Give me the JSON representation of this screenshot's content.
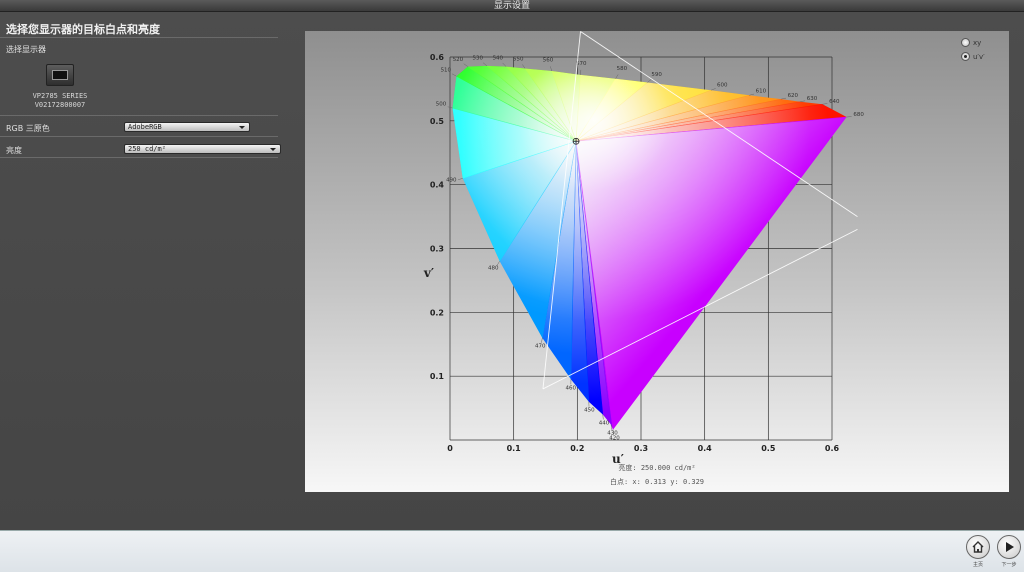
{
  "window": {
    "title": "显示设置"
  },
  "page": {
    "heading": "选择您显示器的目标白点和亮度"
  },
  "left": {
    "select_display_label": "选择显示器",
    "monitor_model": "VP2785 SERIES",
    "monitor_serial": "V02172800007",
    "rgb_label": "RGB 三原色",
    "rgb_value": "AdobeRGB",
    "brightness_label": "亮度",
    "brightness_value": "250 cd/m²"
  },
  "radios": [
    {
      "label": "xy",
      "selected": false
    },
    {
      "label": "u′v′",
      "selected": true
    }
  ],
  "chart_info": {
    "brightness_text": "亮度:  250.000 cd/m²",
    "whitepoint_text": "白点:  x: 0.313  y: 0.329"
  },
  "chart_data": {
    "type": "scatter",
    "title": "",
    "xlabel": "u′",
    "ylabel": "v′",
    "xlim": [
      0,
      0.6
    ],
    "ylim": [
      0,
      0.6
    ],
    "x_ticks": [
      "0",
      "0.1",
      "0.2",
      "0.3",
      "0.4",
      "0.5",
      "0.6"
    ],
    "y_ticks": [
      "0.1",
      "0.2",
      "0.3",
      "0.4",
      "0.5",
      "0.6"
    ],
    "grid": true,
    "spectral_locus": [
      {
        "nm": "420",
        "u": 0.256,
        "v": 0.016
      },
      {
        "nm": "430",
        "u": 0.253,
        "v": 0.024
      },
      {
        "nm": "440",
        "u": 0.24,
        "v": 0.04
      },
      {
        "nm": "450",
        "u": 0.218,
        "v": 0.06
      },
      {
        "nm": "460",
        "u": 0.19,
        "v": 0.095
      },
      {
        "nm": "470",
        "u": 0.145,
        "v": 0.16
      },
      {
        "nm": "480",
        "u": 0.078,
        "v": 0.28
      },
      {
        "nm": "490",
        "u": 0.02,
        "v": 0.41
      },
      {
        "nm": "500",
        "u": 0.004,
        "v": 0.52
      },
      {
        "nm": "510",
        "u": 0.01,
        "v": 0.57
      },
      {
        "nm": "520",
        "u": 0.028,
        "v": 0.585
      },
      {
        "nm": "530",
        "u": 0.058,
        "v": 0.586
      },
      {
        "nm": "540",
        "u": 0.088,
        "v": 0.585
      },
      {
        "nm": "550",
        "u": 0.118,
        "v": 0.582
      },
      {
        "nm": "560",
        "u": 0.16,
        "v": 0.578
      },
      {
        "nm": "570",
        "u": 0.205,
        "v": 0.572
      },
      {
        "nm": "580",
        "u": 0.26,
        "v": 0.566
      },
      {
        "nm": "590",
        "u": 0.31,
        "v": 0.56
      },
      {
        "nm": "600",
        "u": 0.41,
        "v": 0.548
      },
      {
        "nm": "610",
        "u": 0.47,
        "v": 0.54
      },
      {
        "nm": "620",
        "u": 0.52,
        "v": 0.534
      },
      {
        "nm": "630",
        "u": 0.55,
        "v": 0.53
      },
      {
        "nm": "640",
        "u": 0.585,
        "v": 0.526
      },
      {
        "nm": "680",
        "u": 0.623,
        "v": 0.506
      }
    ],
    "white_point": {
      "u": 0.198,
      "v": 0.468
    },
    "guide_lines": [
      {
        "u1": 0.146,
        "v1": 0.08,
        "u2": 0.205,
        "v2": 0.64
      },
      {
        "u1": 0.205,
        "v1": 0.64,
        "u2": 0.64,
        "v2": 0.35
      },
      {
        "u1": 0.146,
        "v1": 0.08,
        "u2": 0.64,
        "v2": 0.33
      }
    ]
  },
  "footer": {
    "home_label": "主页",
    "next_label": "下一步"
  },
  "colors": {
    "panel_top": "#8f8f8f",
    "panel_bottom": "#f7f7f7",
    "chrome_bg": "#4a4a4a",
    "footer_bg": "#e6ebef"
  }
}
